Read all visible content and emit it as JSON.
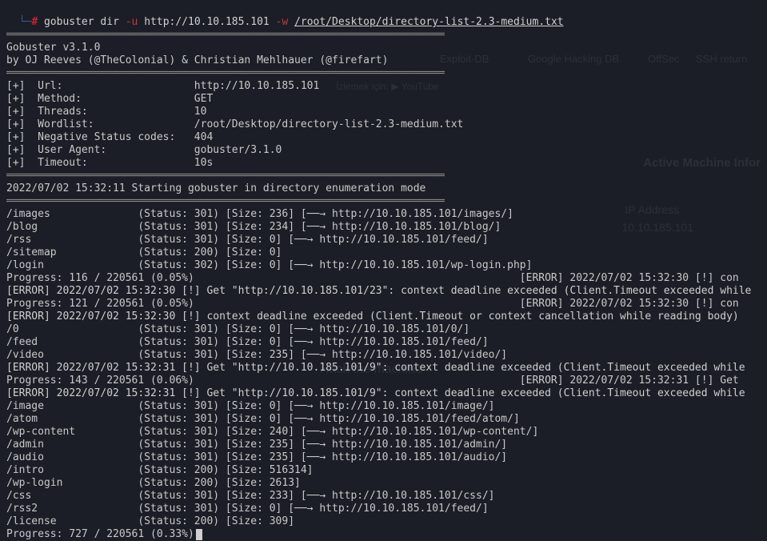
{
  "prompt": {
    "elbow": "└─",
    "hash": "#",
    "cmd": "gobuster",
    "sub": "dir",
    "flag_u": "-u",
    "url": "http://10.10.185.101",
    "flag_w": "-w",
    "wordlist": "/root/Desktop/directory-list-2.3-medium.txt"
  },
  "sep": "══════════════════════════════════════════════════════════════════════",
  "banner1": "Gobuster v3.1.0",
  "banner2": "by OJ Reeves (@TheColonial) & Christian Mehlhauer (@firefart)",
  "info": [
    "[+]  Url:                     http://10.10.185.101",
    "[+]  Method:                  GET",
    "[+]  Threads:                 10",
    "[+]  Wordlist:                /root/Desktop/directory-list-2.3-medium.txt",
    "[+]  Negative Status codes:   404",
    "[+]  User Agent:              gobuster/3.1.0",
    "[+]  Timeout:                 10s"
  ],
  "start": "2022/07/02 15:32:11 Starting gobuster in directory enumeration mode",
  "lines": [
    "/images              (Status: 301) [Size: 236] [──→ http://10.10.185.101/images/]",
    "/blog                (Status: 301) [Size: 234] [──→ http://10.10.185.101/blog/]",
    "/rss                 (Status: 301) [Size: 0] [──→ http://10.10.185.101/feed/]",
    "/sitemap             (Status: 200) [Size: 0]",
    "/login               (Status: 302) [Size: 0] [──→ http://10.10.185.101/wp-login.php]",
    "Progress: 116 / 220561 (0.05%)                                                    [ERROR] 2022/07/02 15:32:30 [!] con",
    "[ERROR] 2022/07/02 15:32:30 [!] Get \"http://10.10.185.101/23\": context deadline exceeded (Client.Timeout exceeded while",
    "Progress: 121 / 220561 (0.05%)                                                    [ERROR] 2022/07/02 15:32:30 [!] con",
    "[ERROR] 2022/07/02 15:32:30 [!] context deadline exceeded (Client.Timeout or context cancellation while reading body)",
    "/0                   (Status: 301) [Size: 0] [──→ http://10.10.185.101/0/]",
    "/feed                (Status: 301) [Size: 0] [──→ http://10.10.185.101/feed/]",
    "/video               (Status: 301) [Size: 235] [──→ http://10.10.185.101/video/]",
    "[ERROR] 2022/07/02 15:32:31 [!] Get \"http://10.10.185.101/9\": context deadline exceeded (Client.Timeout exceeded while ",
    "Progress: 143 / 220561 (0.06%)                                                    [ERROR] 2022/07/02 15:32:31 [!] Get",
    "[ERROR] 2022/07/02 15:32:31 [!] Get \"http://10.10.185.101/9\": context deadline exceeded (Client.Timeout exceeded while",
    "/image               (Status: 301) [Size: 0] [──→ http://10.10.185.101/image/]",
    "/atom                (Status: 301) [Size: 0] [──→ http://10.10.185.101/feed/atom/]",
    "/wp-content          (Status: 301) [Size: 240] [──→ http://10.10.185.101/wp-content/]",
    "/admin               (Status: 301) [Size: 235] [──→ http://10.10.185.101/admin/]",
    "/audio               (Status: 301) [Size: 235] [──→ http://10.10.185.101/audio/]",
    "/intro               (Status: 200) [Size: 516314]",
    "/wp-login            (Status: 200) [Size: 2613]",
    "/css                 (Status: 301) [Size: 233] [──→ http://10.10.185.101/css/]",
    "/rss2                (Status: 301) [Size: 0] [──→ http://10.10.185.101/feed/]",
    "/license             (Status: 200) [Size: 309]",
    "Progress: 727 / 220561 (0.33%)"
  ],
  "ghost": {
    "active": "Active Machine Infor",
    "ip_label": "IP Address",
    "ip_value": "10.10.185.101",
    "exploit": "Exploit-DB",
    "ghdb": "Google Hacking DB",
    "offsec": "OffSec",
    "ssh": "SSH return",
    "youtube": "İzlemek için:  ▶ YouTube",
    "hack": "Hack the machine"
  }
}
